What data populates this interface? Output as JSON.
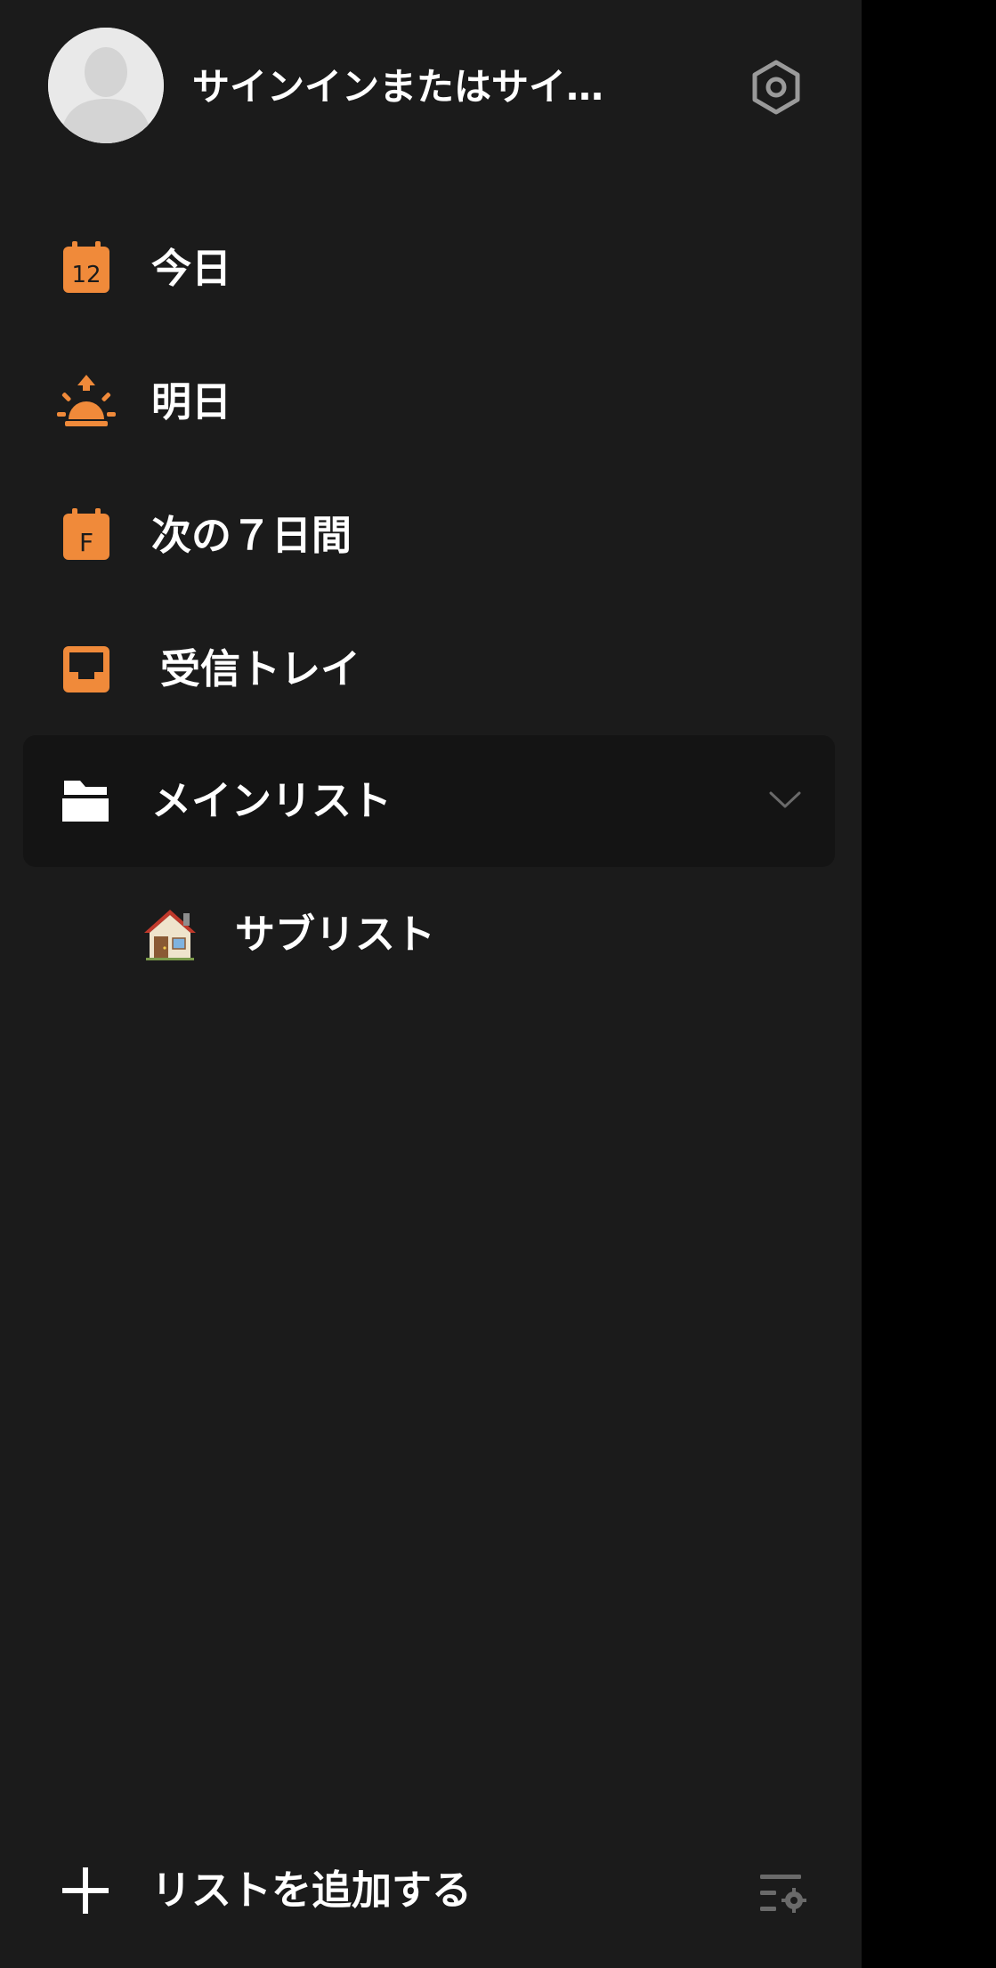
{
  "header": {
    "sign_in_label": "サインインまたはサイ…",
    "avatar_icon": "user-placeholder-icon",
    "settings_icon": "hexagon-gear-icon"
  },
  "nav": {
    "items": [
      {
        "label": "今日",
        "icon": "calendar-today-icon",
        "icon_text": "12"
      },
      {
        "label": "明日",
        "icon": "sunrise-icon"
      },
      {
        "label": "次の７日間",
        "icon": "calendar-week-icon",
        "icon_text": "F"
      },
      {
        "label": "受信トレイ",
        "icon": "inbox-icon"
      }
    ],
    "main_list": {
      "label": "メインリスト",
      "icon": "folder-open-icon",
      "expand_icon": "chevron-down-icon"
    },
    "sub_list": {
      "label": "サブリスト",
      "emoji": "🏠"
    }
  },
  "footer": {
    "add_list_label": "リストを追加する",
    "add_icon": "plus-icon",
    "list_settings_icon": "list-settings-icon"
  },
  "colors": {
    "drawer_bg": "#1b1b1b",
    "selected_bg": "#141414",
    "accent_orange": "#f08a3a",
    "icon_gray": "#9a9a9a",
    "text": "#ffffff"
  }
}
